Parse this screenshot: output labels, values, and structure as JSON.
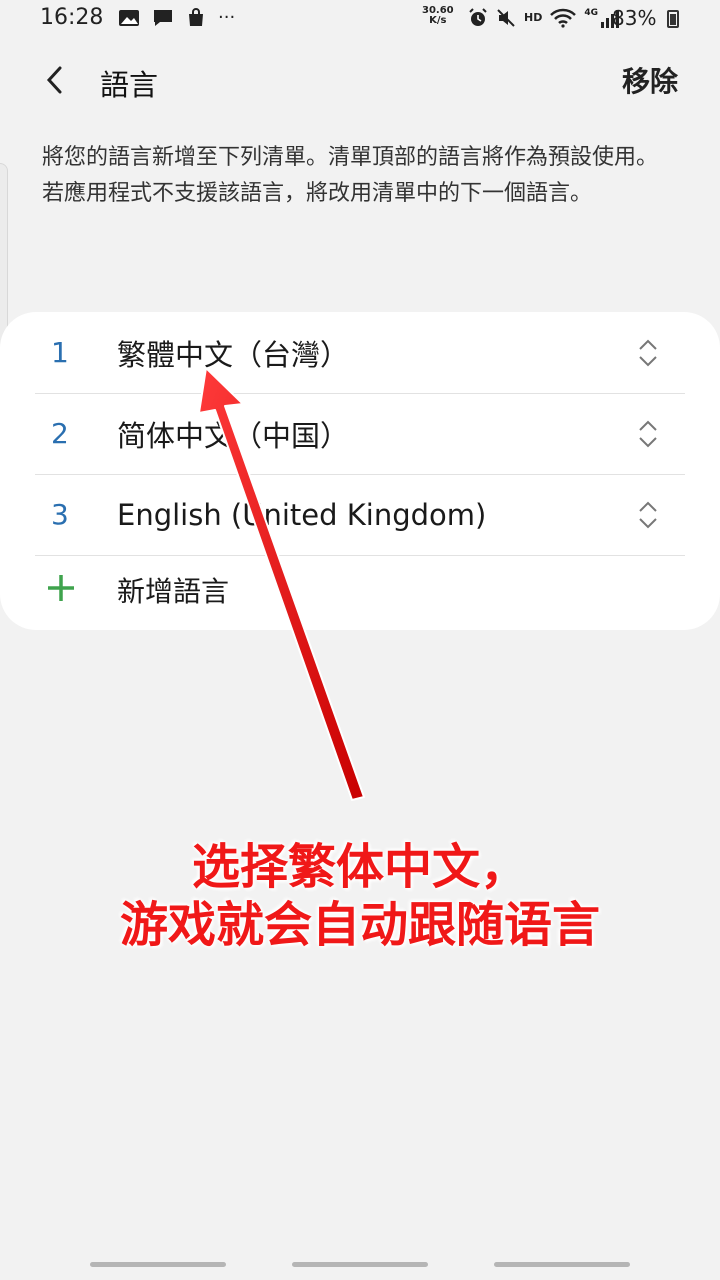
{
  "status_bar": {
    "time": "16:28",
    "network_speed_value": "30.60",
    "network_speed_unit": "K/s",
    "hd_label": "HD",
    "signal_label": "4G",
    "battery": "83%",
    "left_icons": [
      "gallery-icon",
      "message-icon",
      "shopping-bag-icon",
      "more-dots-icon"
    ],
    "right_icons": [
      "alarm-icon",
      "mute-icon",
      "hd-icon",
      "wifi-icon",
      "signal-icon",
      "battery-icon"
    ]
  },
  "app_bar": {
    "title": "語言",
    "remove_label": "移除"
  },
  "description": {
    "line1": "將您的語言新增至下列清單。清單頂部的語言將作為預設使用。",
    "line2": "若應用程式不支援該語言，將改用清單中的下一個語言。"
  },
  "languages": [
    {
      "number": "1",
      "label": "繁體中文（台灣）"
    },
    {
      "number": "2",
      "label": "简体中文（中国）"
    },
    {
      "number": "3",
      "label": "English (United Kingdom)"
    }
  ],
  "add_language_label": "新增語言",
  "annotation": {
    "line1": "选择繁体中文，",
    "line2": "游戏就会自动跟随语言"
  },
  "colors": {
    "accent_number": "#2a6fb0",
    "add_icon": "#3fa34d",
    "annotation": "#f01818"
  }
}
